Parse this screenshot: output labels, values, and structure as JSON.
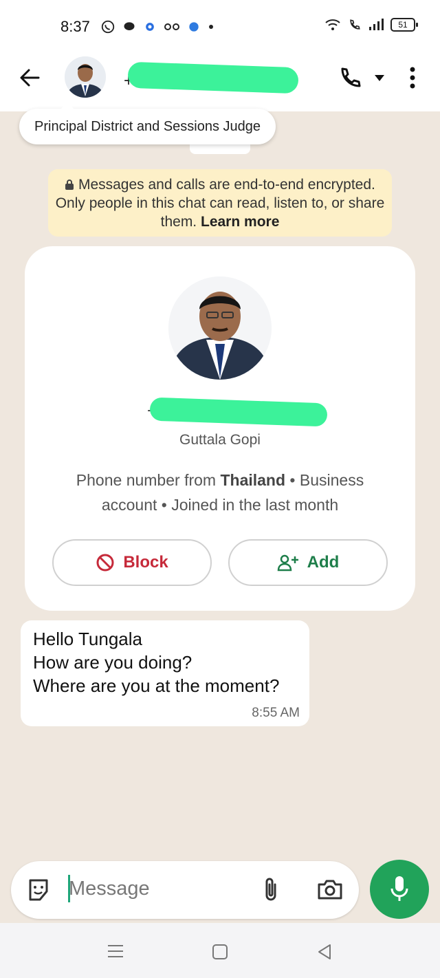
{
  "status_bar": {
    "time": "8:37",
    "battery": "51"
  },
  "header": {
    "contact_number": "+6…",
    "redacted": true
  },
  "tooltip": {
    "text": "Principal District and Sessions Judge"
  },
  "encryption_notice": {
    "text": "Messages and calls are end-to-end encrypted. Only people in this chat can read, listen to, or share them.",
    "link": "Learn more"
  },
  "contact_card": {
    "phone_redacted": "+6…",
    "name": "Guttala Gopi",
    "info_prefix": "Phone number from",
    "country": "Thailand",
    "info_suffix": "• Business account • Joined in the last month",
    "block_label": "Block",
    "add_label": "Add"
  },
  "message": {
    "lines": [
      "Hello Tungala",
      "How are you doing?",
      "Where are you at the moment?"
    ],
    "time": "8:55 AM"
  },
  "composer": {
    "placeholder": "Message"
  },
  "colors": {
    "accent": "#21a35a",
    "block_red": "#c62a3a",
    "add_green": "#1e7e4a",
    "encryption_bg": "#fdf0c8",
    "redaction": "#3cf29a"
  }
}
